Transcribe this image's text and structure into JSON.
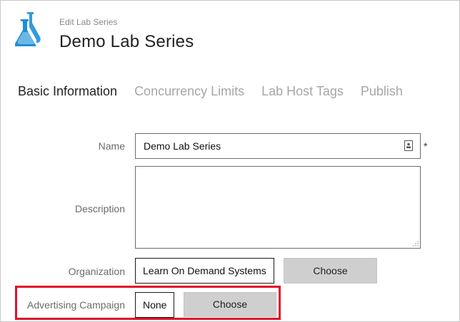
{
  "header": {
    "subtitle": "Edit Lab Series",
    "title": "Demo Lab Series",
    "icon": "lab-flask-icon"
  },
  "tabs": [
    {
      "label": "Basic Information",
      "active": true
    },
    {
      "label": "Concurrency Limits",
      "active": false
    },
    {
      "label": "Lab Host Tags",
      "active": false
    },
    {
      "label": "Publish",
      "active": false
    }
  ],
  "form": {
    "name": {
      "label": "Name",
      "value": "Demo Lab Series",
      "required_marker": "*"
    },
    "description": {
      "label": "Description",
      "value": ""
    },
    "organization": {
      "label": "Organization",
      "value": "Learn On Demand Systems",
      "button": "Choose"
    },
    "advertising_campaign": {
      "label": "Advertising Campaign",
      "value": "None",
      "button": "Choose"
    }
  },
  "colors": {
    "accent_flask": "#1e8fd6",
    "highlight_border": "#e0112b",
    "inactive_tab": "#a6a6a6",
    "button_bg": "#cfcfcf"
  }
}
